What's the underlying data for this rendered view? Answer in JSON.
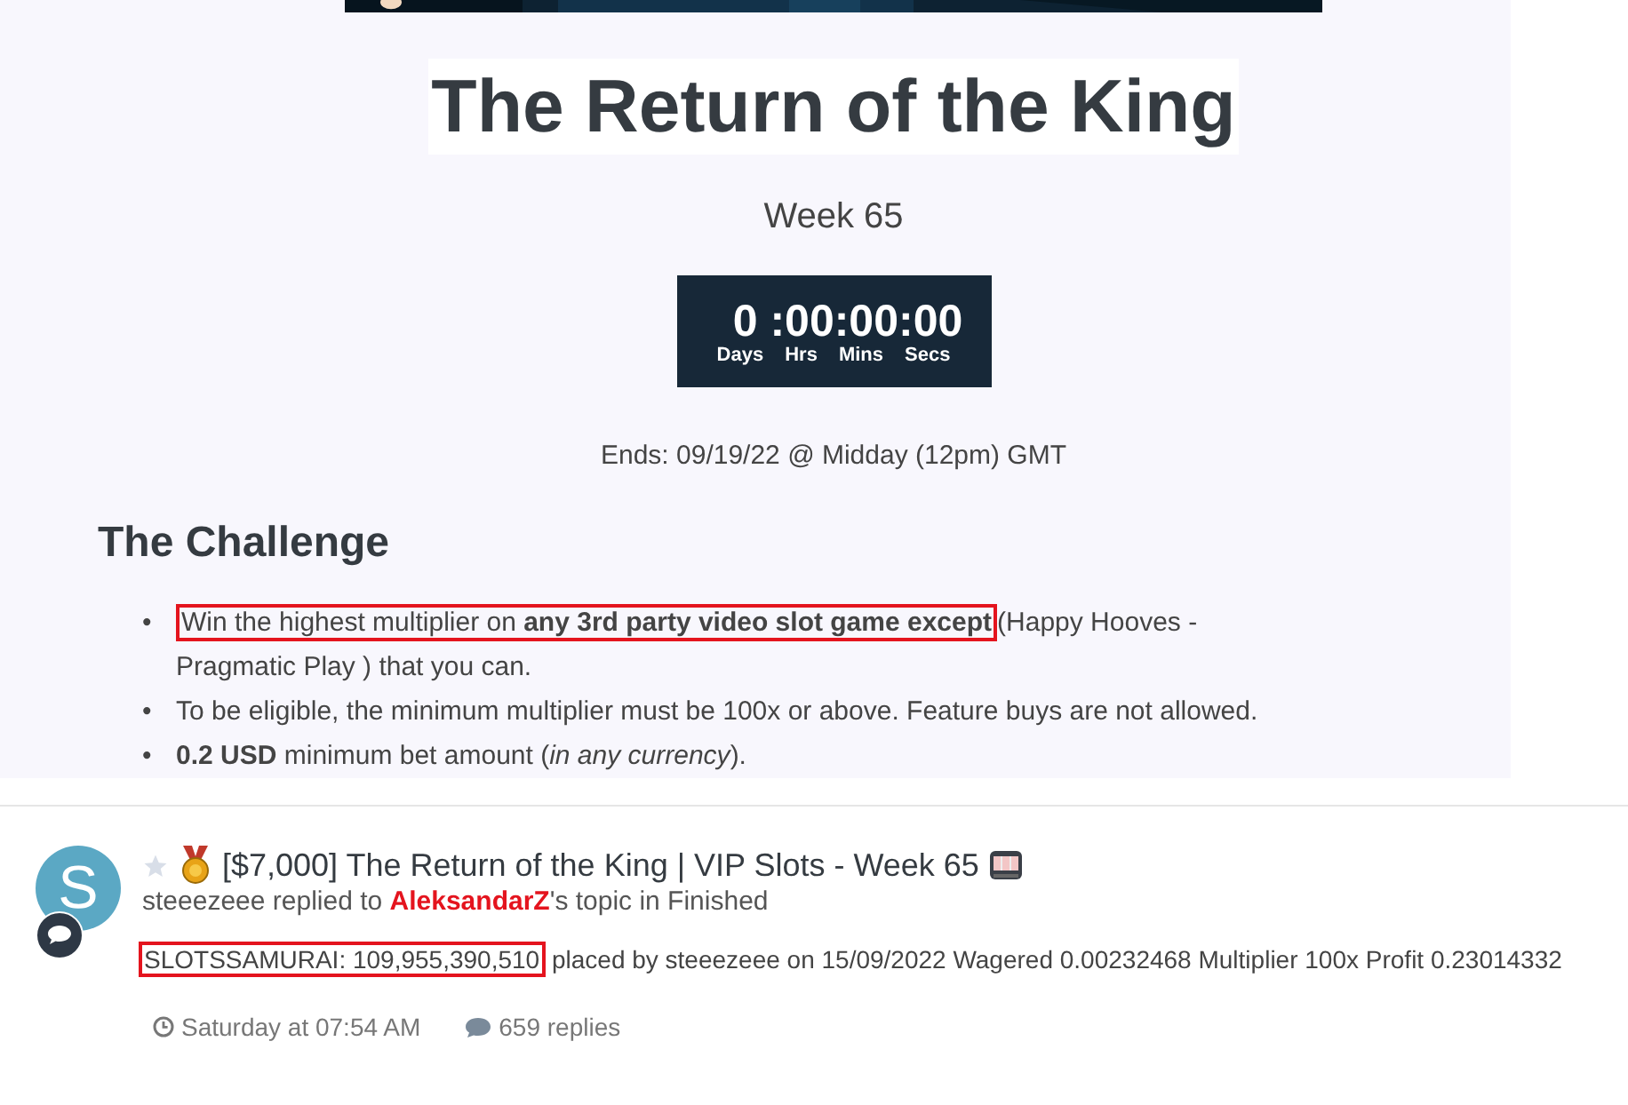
{
  "article": {
    "title": "The Return of the King",
    "subtitle": "Week 65",
    "countdown": {
      "value": "0 :00:00:00",
      "units": [
        "Days",
        "Hrs",
        "Mins",
        "Secs"
      ]
    },
    "ends": "Ends: 09/19/22 @ Midday (12pm) GMT",
    "section_heading": "The Challenge",
    "bullets": [
      {
        "marker": "•",
        "highlight": "Win the highest multiplier on **any 3rd party video slot game except**",
        "text": "(Happy Hooves - Pragmatic Play ) that you can."
      },
      {
        "marker": "•",
        "text": "To be eligible, the minimum multiplier must be 100x or above. Feature buys are not allowed."
      },
      {
        "marker": "•",
        "text": "**0.2 USD** minimum bet amount (*in any currency*)."
      }
    ]
  },
  "activity": {
    "avatar_letter": "S",
    "starred": false,
    "topic_title": "[$7,000] The Return of the King | VIP Slots - Week 65",
    "user": "steeezeee",
    "action": " replied to ",
    "topic_author": "AleksandarZ",
    "action_end": "'s topic in Finished",
    "highlight": "SLOTSSAMURAI: 109,955,390,510",
    "snippet": "placed by steeezeee on 15/09/2022 Wagered 0.00232468 Multiplier 100x Profit 0.23014332",
    "time": "Saturday at 07:54 AM",
    "replies": "659 replies"
  }
}
